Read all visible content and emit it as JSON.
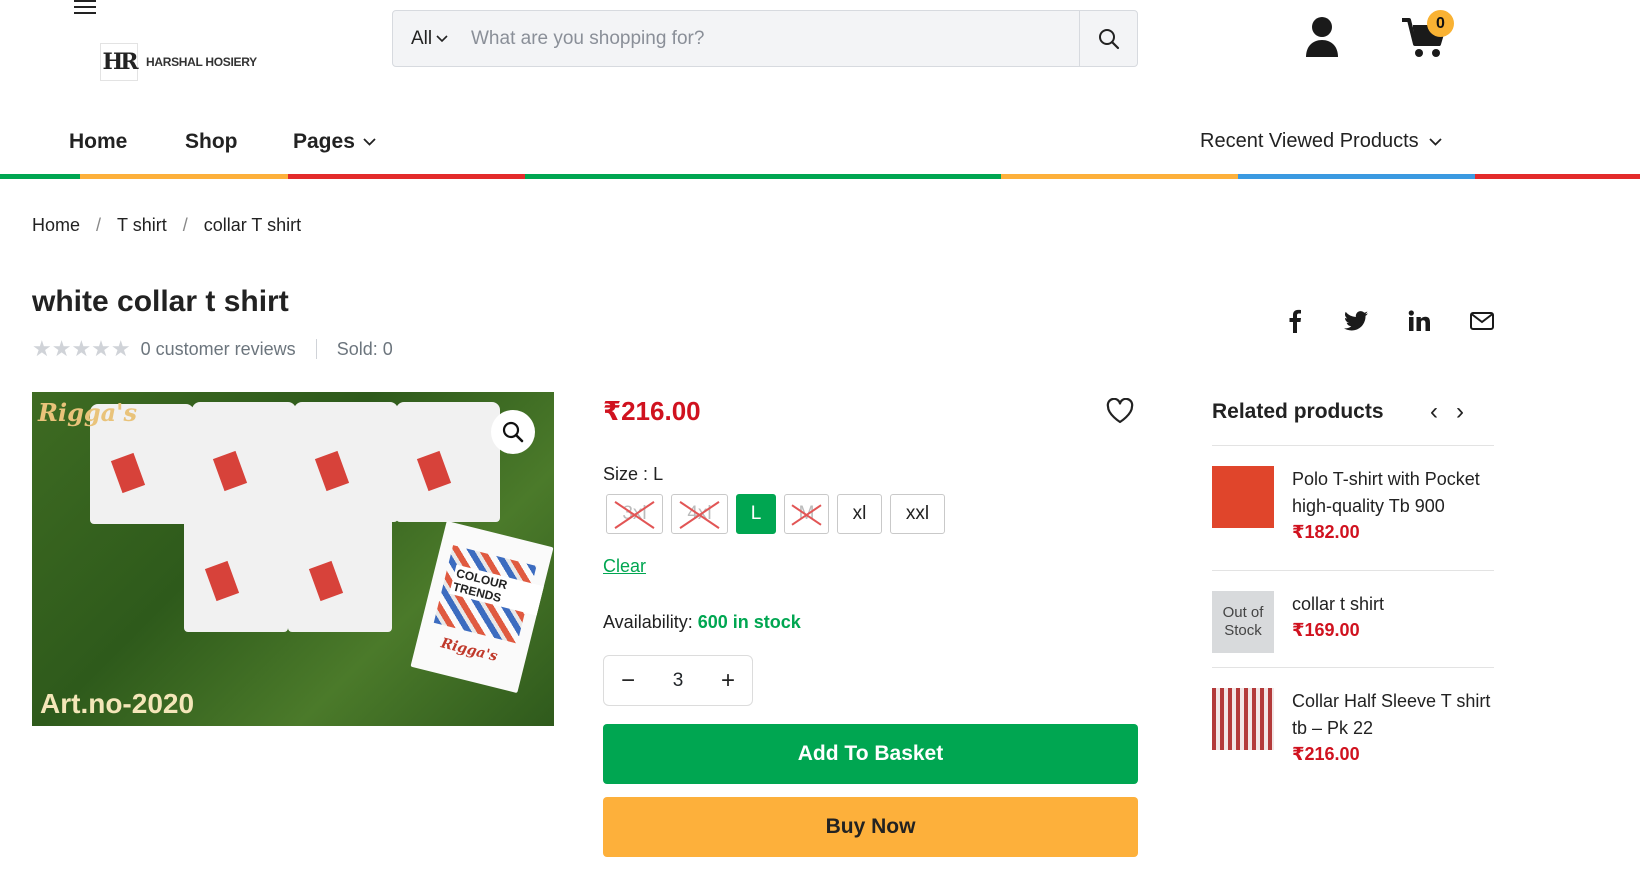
{
  "brand": {
    "logo_mark": "HR",
    "logo_text": "HARSHAL HOSIERY"
  },
  "search": {
    "category": "All",
    "placeholder": "What are you shopping for?"
  },
  "cart": {
    "count": "0"
  },
  "nav": {
    "items": [
      {
        "label": "Home"
      },
      {
        "label": "Shop"
      },
      {
        "label": "Pages"
      }
    ],
    "recent": "Recent Viewed Products"
  },
  "colorbar": [
    "#00a651",
    "#fdb03b",
    "#e32b2b",
    "#00a651",
    "#fdb03b",
    "#3b9ae1",
    "#e32b2b"
  ],
  "breadcrumb": [
    "Home",
    "T shirt",
    "collar T shirt"
  ],
  "product": {
    "title": "white collar t shirt",
    "reviews": "0 customer reviews",
    "sold": "Sold: 0",
    "price": "₹216.00",
    "size_label": "Size",
    "size_selected": "L",
    "sizes": [
      {
        "label": "3xl",
        "state": "disabled"
      },
      {
        "label": "4xl",
        "state": "disabled"
      },
      {
        "label": "L",
        "state": "active"
      },
      {
        "label": "M",
        "state": "disabled"
      },
      {
        "label": "xl",
        "state": "available"
      },
      {
        "label": "xxl",
        "state": "available"
      }
    ],
    "clear": "Clear",
    "availability_label": "Availability:",
    "availability_value": "600 in stock",
    "quantity": "3",
    "add_to_basket": "Add To Basket",
    "buy_now": "Buy Now",
    "image_brand": "Rigga's",
    "image_caption": "Art.no-2020",
    "image_book_text": "COLOUR TRENDS",
    "image_book_brand": "Rigga's"
  },
  "related": {
    "title": "Related products",
    "items": [
      {
        "name": "Polo T-shirt with Pocket high-quality Tb 900",
        "price": "₹182.00",
        "thumb_color": "#e0452b",
        "badge": ""
      },
      {
        "name": "collar t shirt",
        "price": "₹169.00",
        "thumb_color": "#c9d3da",
        "badge": "Out of Stock"
      },
      {
        "name": "Collar Half Sleeve T shirt tb – Pk 22",
        "price": "₹216.00",
        "thumb_color": "#b33a3a",
        "badge": ""
      }
    ]
  }
}
